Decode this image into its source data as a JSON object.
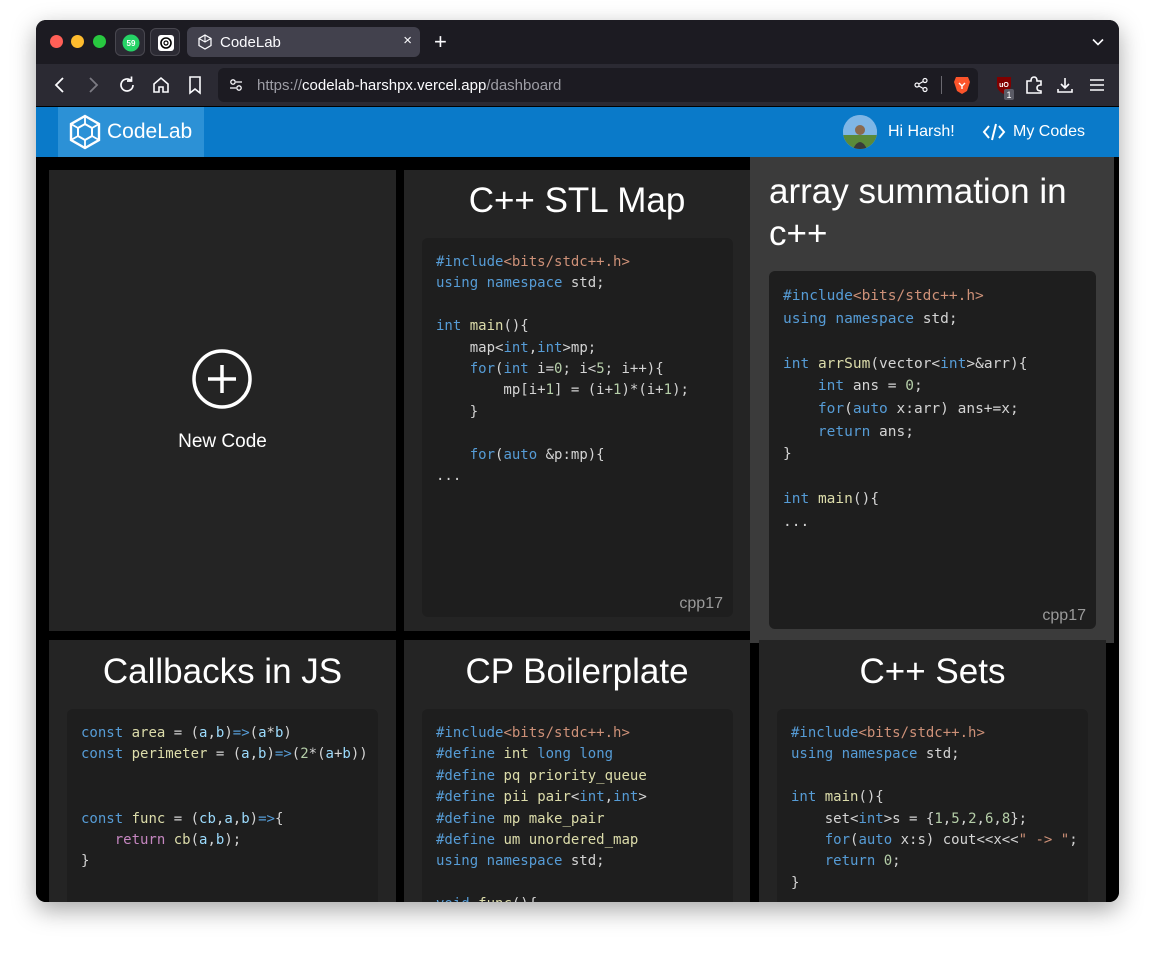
{
  "browser": {
    "tab": {
      "title": "CodeLab",
      "close": "×"
    },
    "pinned_badge": "59",
    "new_tab": "+",
    "url": {
      "scheme": "https://",
      "host": "codelab-harshpx.vercel.app",
      "path": "/dashboard"
    },
    "ublock_count": "1",
    "colors": {
      "close": "#ff5f57",
      "minimize": "#febc2e",
      "maximize": "#28c840"
    }
  },
  "header": {
    "brand": "CodeLab",
    "greeting": "Hi Harsh!",
    "my_codes": "My Codes",
    "color": "#0a7ac9"
  },
  "new_code": {
    "label": "New Code"
  },
  "cards": [
    {
      "title": "C++ STL Map",
      "language": "cpp17",
      "code": "#include<bits/stdc++.h>\nusing namespace std;\n\nint main(){\n    map<int,int>mp;\n    for(int i=0; i<5; i++){\n        mp[i+1] = (i+1)*(i+1);\n    }\n\n    for(auto &p:mp){\n..."
    },
    {
      "title": "array summation in c++",
      "language": "cpp17",
      "code": "#include<bits/stdc++.h>\nusing namespace std;\n\nint arrSum(vector<int>&arr){\n    int ans = 0;\n    for(auto x:arr) ans+=x;\n    return ans;\n}\n\nint main(){\n..."
    },
    {
      "title": "Callbacks in JS",
      "language": "",
      "code": "const area = (a,b)=>(a*b)\nconst perimeter = (a,b)=>(2*(a+b))\n\n\nconst func = (cb,a,b)=>{\n    return cb(a,b);\n}"
    },
    {
      "title": "CP Boilerplate",
      "language": "",
      "code": "#include<bits/stdc++.h>\n#define int long long\n#define pq priority_queue\n#define pii pair<int,int>\n#define mp make_pair\n#define um unordered_map\nusing namespace std;\n\nvoid func(){"
    },
    {
      "title": "C++ Sets",
      "language": "",
      "code": "#include<bits/stdc++.h>\nusing namespace std;\n\nint main(){\n    set<int>s = {1,5,2,6,8};\n    for(auto x:s) cout<<x<<\" -> \";\n    return 0;\n}"
    }
  ]
}
